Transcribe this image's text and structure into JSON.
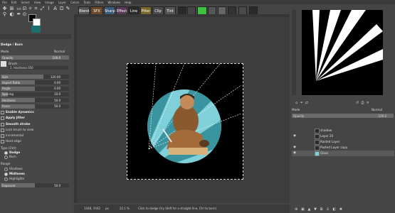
{
  "menu": [
    "File",
    "Edit",
    "Select",
    "View",
    "Image",
    "Layer",
    "Colors",
    "Tools",
    "Filters",
    "Windows",
    "Help"
  ],
  "plugins": [
    "Blend",
    "SFX",
    "Sharp",
    "Effect",
    "Line",
    "Filter",
    "Clip",
    "Tint"
  ],
  "tool_options": {
    "title": "Dodge / Burn",
    "mode_label": "Mode",
    "mode_value": "Normal",
    "opacity_label": "Opacity",
    "opacity_value": "100.0",
    "brush_label": "Brush",
    "brush_value": "2. Hardness 050",
    "sliders": [
      {
        "label": "Size",
        "value": "120.00",
        "fill": 0.62
      },
      {
        "label": "Aspect Ratio",
        "value": "0.00",
        "fill": 0.5
      },
      {
        "label": "Angle",
        "value": "0.00",
        "fill": 0.5
      },
      {
        "label": "Spacing",
        "value": "10.0",
        "fill": 0.1
      },
      {
        "label": "Hardness",
        "value": "50.0",
        "fill": 0.5
      },
      {
        "label": "Force",
        "value": "50.0",
        "fill": 0.5
      }
    ],
    "dynamics_label": "Enable dynamics",
    "jitter_label": "Apply Jitter",
    "smooth_label": "Smooth stroke",
    "lock_label": "Lock brush to view",
    "incremental_label": "Incremental",
    "hard_edge_label": "Hard edge",
    "type_label": "Type  (Ctrl)",
    "type_options": [
      "Dodge",
      "Burn"
    ],
    "range_label": "Range",
    "range_options": [
      "Shadows",
      "Midtones",
      "Highlights"
    ],
    "exposure_label": "Exposure",
    "exposure_value": "50.0",
    "exposure_fill": 0.5
  },
  "status": {
    "coords": "1448, 1042",
    "unit": "px",
    "zoom": "22.1 %",
    "message": "Click to dodge (try Shift for a straight line, Ctrl to burn)"
  },
  "layers": {
    "mode_label": "Mode",
    "mode_value": "Normal",
    "opacity_label": "Opacity",
    "opacity_value": "100.0",
    "items": [
      "shadow",
      "Layer 25",
      "Rasted Layer",
      "Pasted Layer copy",
      "Glass"
    ]
  }
}
